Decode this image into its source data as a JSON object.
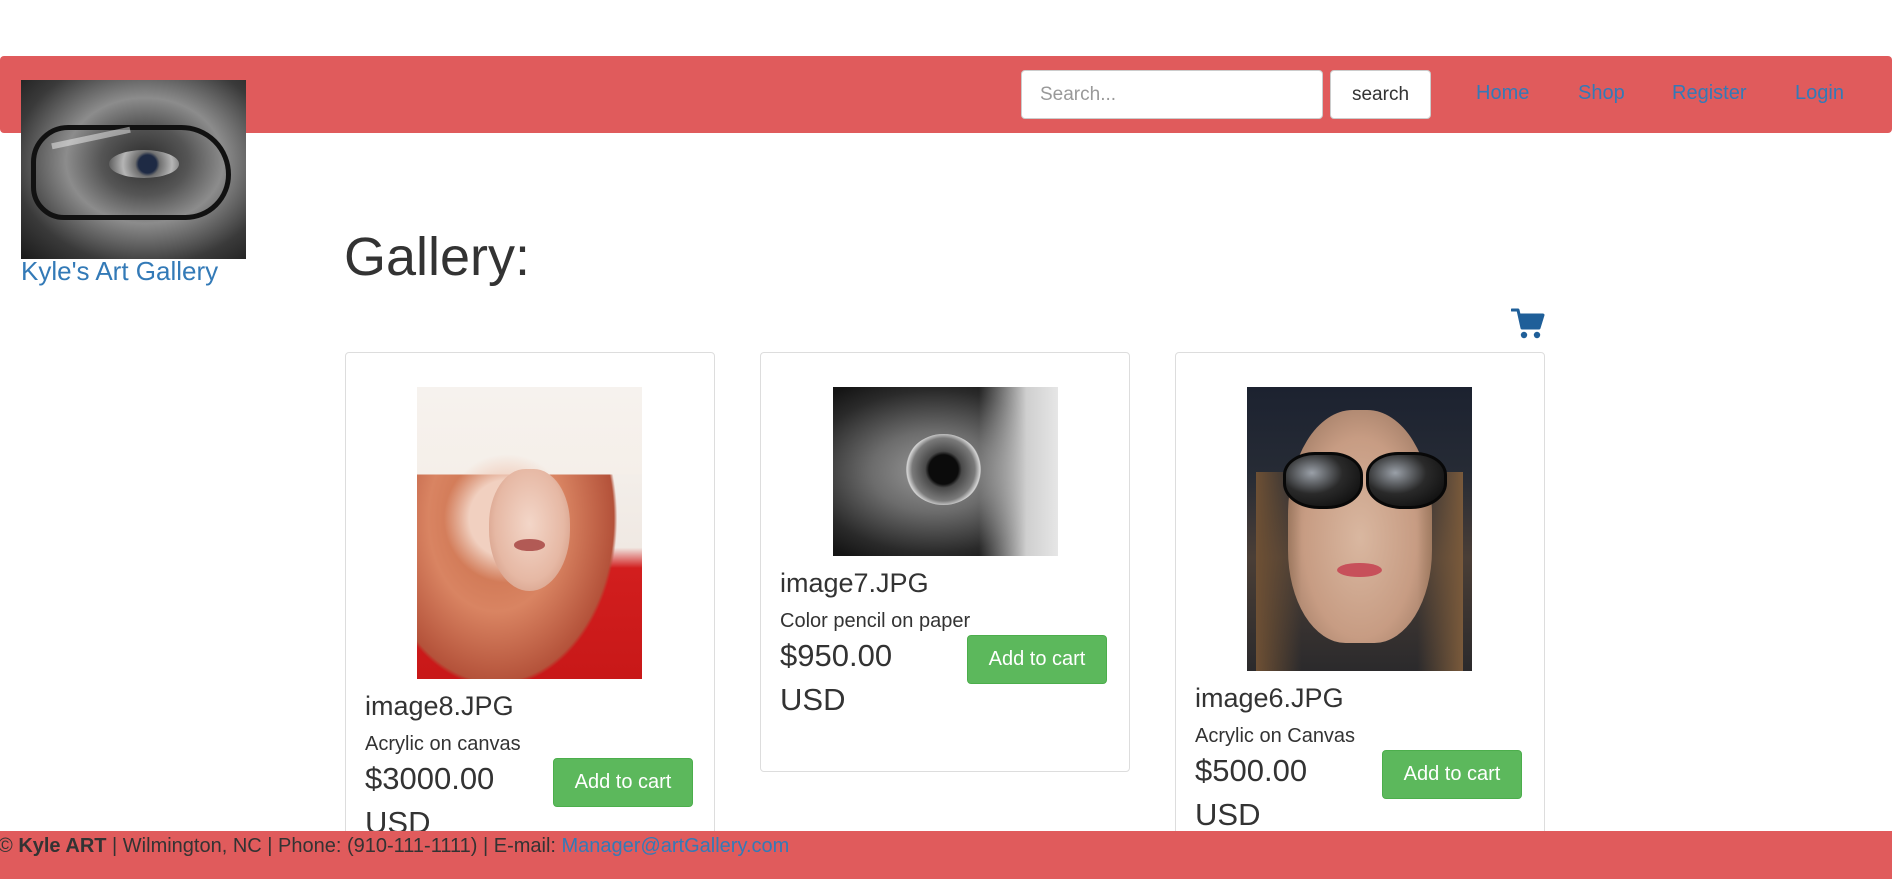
{
  "brand": {
    "name": "Kyle's Art Gallery",
    "logo_icon": "portrait-eye-glasses-image"
  },
  "search": {
    "placeholder": "Search...",
    "value": "",
    "button_label": "search"
  },
  "nav": {
    "items": [
      {
        "label": "Home"
      },
      {
        "label": "Shop"
      },
      {
        "label": "Register"
      },
      {
        "label": "Login"
      }
    ]
  },
  "main": {
    "title": "Gallery:",
    "cart_icon": "shopping-cart-icon"
  },
  "products": [
    {
      "name": "image8.JPG",
      "description": "Acrylic on canvas",
      "price": "$3000.00 USD",
      "button_label": "Add to cart"
    },
    {
      "name": "image7.JPG",
      "description": "Color pencil on paper",
      "price": "$950.00 USD",
      "button_label": "Add to cart"
    },
    {
      "name": "image6.JPG",
      "description": "Acrylic on Canvas",
      "price": "$500.00 USD",
      "button_label": "Add to cart"
    }
  ],
  "footer": {
    "copyright_symbol": "©",
    "company": "Kyle ART",
    "details": "| Wilmington, NC | Phone: (910-111-1111) | E-mail:",
    "email": "Manager@artGallery.com"
  },
  "colors": {
    "navbar": "#e05b5c",
    "link": "#337ab7",
    "button_success": "#5cb85c",
    "cart_icon": "#1f5f99"
  }
}
